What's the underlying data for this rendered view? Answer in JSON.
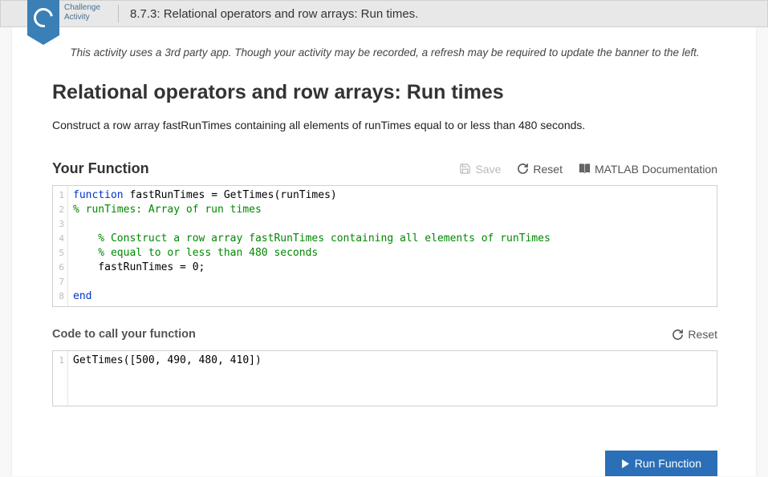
{
  "badge": {
    "line1": "Challenge",
    "line2": "Activity"
  },
  "header": {
    "title": "8.7.3: Relational operators and row arrays: Run times."
  },
  "notice": "This activity uses a 3rd party app. Though your activity may be recorded, a refresh may be required to update the banner to the left.",
  "main_heading": "Relational operators and row arrays: Run times",
  "instructions": "Construct a row array fastRunTimes containing all elements of runTimes equal to or less than 480 seconds.",
  "your_function": {
    "title": "Your Function",
    "save_label": "Save",
    "reset_label": "Reset",
    "docs_label": "MATLAB Documentation",
    "code_lines": {
      "l1_kw": "function",
      "l1_rest": " fastRunTimes = GetTimes(runTimes)",
      "l2": "% runTimes: Array of run times",
      "l3": "",
      "l4": "    % Construct a row array fastRunTimes containing all elements of runTimes",
      "l5": "    % equal to or less than 480 seconds",
      "l6": "    fastRunTimes = 0;",
      "l7": "",
      "l8": "end"
    }
  },
  "call_section": {
    "title": "Code to call your function",
    "reset_label": "Reset",
    "code_lines": {
      "l1": "GetTimes([500, 490, 480, 410])"
    }
  },
  "run_button": "Run Function"
}
